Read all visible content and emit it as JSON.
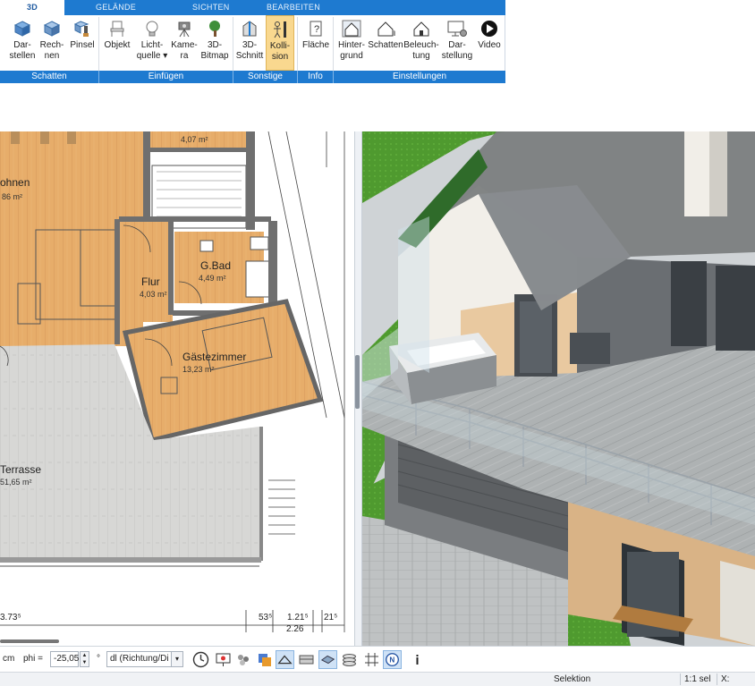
{
  "ribbon": {
    "tabs": [
      {
        "label": "3D",
        "active": true
      },
      {
        "label": "GELÄNDE",
        "active": false
      },
      {
        "label": "SICHTEN",
        "active": false
      },
      {
        "label": "BEARBEITEN",
        "active": false
      }
    ],
    "buttons": [
      {
        "line1": "Dar-",
        "line2": "stellen",
        "icon": "cube-render-icon"
      },
      {
        "line1": "Rech-",
        "line2": "nen",
        "icon": "cube-calculate-icon"
      },
      {
        "line1": "Pinsel",
        "line2": "",
        "icon": "paint-brush-icon"
      },
      {
        "line1": "Objekt",
        "line2": "",
        "icon": "chair-icon"
      },
      {
        "line1": "Licht-",
        "line2": "quelle",
        "icon": "light-bulb-icon"
      },
      {
        "line1": "Kame-",
        "line2": "ra",
        "icon": "camera-icon"
      },
      {
        "line1": "3D-",
        "line2": "Bitmap",
        "icon": "tree-icon"
      },
      {
        "line1": "3D-",
        "line2": "Schnitt",
        "icon": "section-cut-icon"
      },
      {
        "line1": "Kolli-",
        "line2": "sion",
        "icon": "person-collision-icon"
      },
      {
        "line1": "Fläche",
        "line2": "",
        "icon": "area-info-icon"
      },
      {
        "line1": "Hinter-",
        "line2": "grund",
        "icon": "house-background-icon"
      },
      {
        "line1": "Schatten",
        "line2": "",
        "icon": "house-shadow-icon"
      },
      {
        "line1": "Beleuch-",
        "line2": "tung",
        "icon": "house-light-icon"
      },
      {
        "line1": "Dar-",
        "line2": "stellung",
        "icon": "monitor-settings-icon"
      },
      {
        "line1": "Video",
        "line2": "",
        "icon": "play-icon"
      }
    ],
    "groups": [
      "Schatten",
      "Einfügen",
      "Sonstige",
      "Info",
      "Einstellungen"
    ]
  },
  "plan": {
    "rooms": [
      {
        "name": "ohnen",
        "area": "86 m²"
      },
      {
        "name": "",
        "area": "4,07 m²"
      },
      {
        "name": "G.Bad",
        "area": "4,49 m²"
      },
      {
        "name": "Flur",
        "area": "4,03 m²"
      },
      {
        "name": "Gästezimmer",
        "area": "13,23 m²"
      },
      {
        "name": "Terrasse",
        "area": "51,65 m²"
      }
    ],
    "dimensions": [
      "3.73⁵",
      "53⁵",
      "1.21⁵",
      "21⁵",
      "2.26"
    ]
  },
  "toolbar": {
    "unit": "cm",
    "phi_label": "phi =",
    "phi_value": "-25,05",
    "degree": "°",
    "dl_value": "dl (Richtung/Di",
    "icons": [
      "clock-icon",
      "monitor-icon",
      "group-icon",
      "layers-icon",
      "line-draw-icon",
      "pattern-icon",
      "plane-icon",
      "stack-icon",
      "grid-icon",
      "north-icon",
      "info-marker-icon"
    ]
  },
  "status": {
    "mode": "Selektion",
    "scale": "1:1 sel",
    "coord_label": "X:"
  },
  "colors": {
    "ribbon_blue": "#1e7ad0",
    "active_button": "#f9d88f",
    "floor_wood": "#e7ad6a"
  }
}
